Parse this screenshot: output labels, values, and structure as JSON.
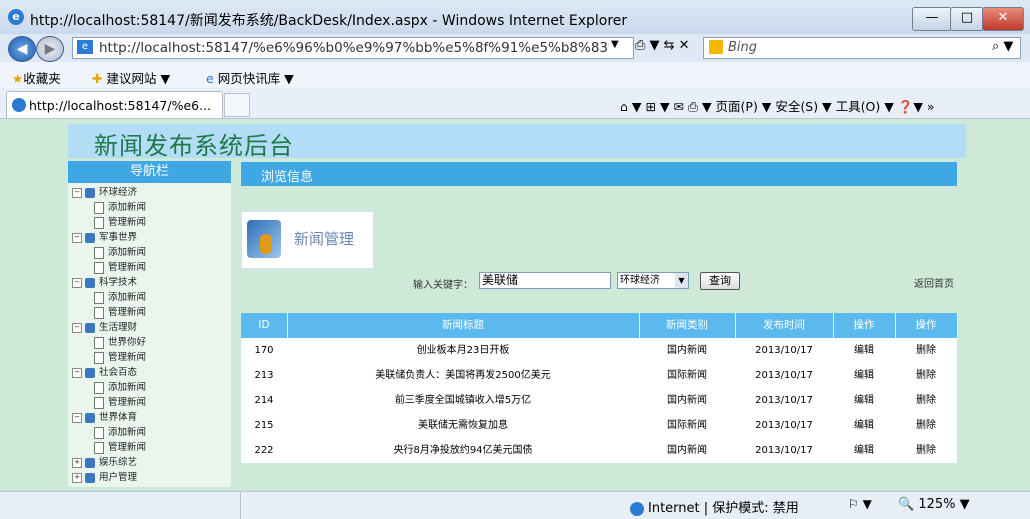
{
  "window": {
    "title": "http://localhost:58147/新闻发布系统/BackDesk/Index.aspx - Windows Internet Explorer",
    "min": "—",
    "max": "□",
    "close": "✕"
  },
  "address": {
    "url": "http://localhost:58147/%e6%96%b0%e9%97%bb%e5%8f%91%e5%b8%83%e7%",
    "dropdown": "▼",
    "buttons": "⎙ ▼ ⇆ ✕"
  },
  "search": {
    "placeholder": "Bing",
    "icon": "⌕ ▼"
  },
  "favbar": {
    "favorites": "收藏夹",
    "suggested": "建议网站 ▼",
    "webslice": "网页快讯库 ▼"
  },
  "tab": {
    "label": "http://localhost:58147/%e6..."
  },
  "commandbar": "⌂ ▼ ⊞ ▼ ✉ ⎙ ▼ 页面(P) ▼ 安全(S) ▼ 工具(O) ▼ ❓▼ »",
  "page": {
    "site_title": "新闻发布系统后台",
    "nav_title": "导航栏",
    "main_title": "浏览信息",
    "logo_text": "新闻管理",
    "kw_label": "输入关键字：",
    "kw_value": "美联储",
    "category_selected": "环球经济",
    "query_button": "查询",
    "home_link": "返回首页"
  },
  "nav": [
    {
      "label": "环球经济",
      "children": [
        "添加新闻",
        "管理新闻"
      ]
    },
    {
      "label": "军事世界",
      "children": [
        "添加新闻",
        "管理新闻"
      ]
    },
    {
      "label": "科学技术",
      "children": [
        "添加新闻",
        "管理新闻"
      ]
    },
    {
      "label": "生活理财",
      "children": [
        "世界你好",
        "管理新闻"
      ]
    },
    {
      "label": "社会百态",
      "children": [
        "添加新闻",
        "管理新闻"
      ]
    },
    {
      "label": "世界体育",
      "children": [
        "添加新闻",
        "管理新闻"
      ]
    },
    {
      "label": "娱乐综艺",
      "children": []
    },
    {
      "label": "用户管理",
      "children": []
    }
  ],
  "table": {
    "headers": [
      "ID",
      "新闻标题",
      "新闻类别",
      "发布时间",
      "操作",
      "操作"
    ],
    "rows": [
      [
        "170",
        "创业板本月23日开板",
        "国内新闻",
        "2013/10/17",
        "编辑",
        "删除"
      ],
      [
        "213",
        "美联储负责人：美国将再发2500亿美元",
        "国际新闻",
        "2013/10/17",
        "编辑",
        "删除"
      ],
      [
        "214",
        "前三季度全国城镇收入增5万亿",
        "国内新闻",
        "2013/10/17",
        "编辑",
        "删除"
      ],
      [
        "215",
        "美联储无需恢复加息",
        "国际新闻",
        "2013/10/17",
        "编辑",
        "删除"
      ],
      [
        "222",
        "央行8月净投放约94亿美元国债",
        "国内新闻",
        "2013/10/17",
        "编辑",
        "删除"
      ]
    ]
  },
  "status": {
    "zone": "Internet | 保护模式: 禁用",
    "zoom": "🔍 125% ▼",
    "security": "⚐ ▼"
  }
}
